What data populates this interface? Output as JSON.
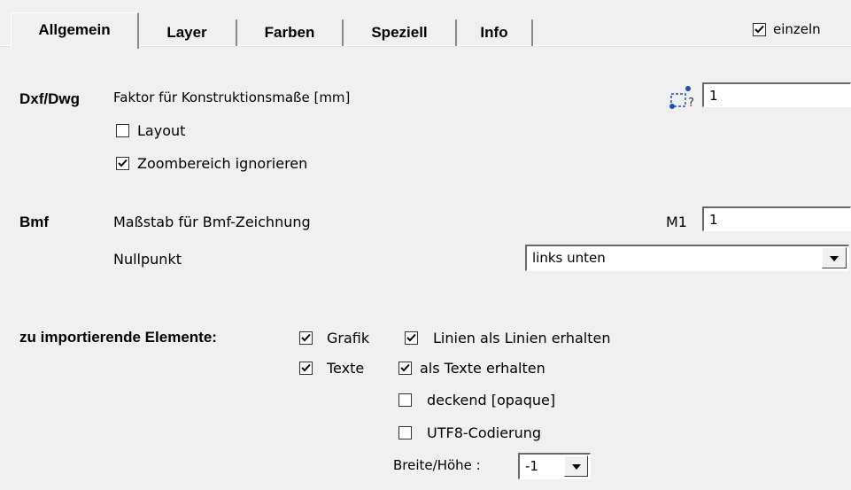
{
  "tabs": [
    {
      "label": "Allgemein",
      "active": true
    },
    {
      "label": "Layer",
      "active": false
    },
    {
      "label": "Farben",
      "active": false
    },
    {
      "label": "Speziell",
      "active": false
    },
    {
      "label": "Info",
      "active": false
    }
  ],
  "einzeln": {
    "label": "einzeln",
    "checked": true
  },
  "dxf": {
    "section_label": "Dxf/Dwg",
    "factor_label": "Faktor für Konstruktionsmaße [mm]",
    "factor_value": "1",
    "pick_icon": "measure-pick-icon",
    "layout": {
      "label": "Layout",
      "checked": false
    },
    "zoom": {
      "label": "Zoombereich ignorieren",
      "checked": true
    }
  },
  "bmf": {
    "section_label": "Bmf",
    "scale_label": "Maßstab für Bmf-Zeichnung",
    "scale_prefix": "M1",
    "scale_value": "1",
    "origin_label": "Nullpunkt",
    "origin_value": "links unten"
  },
  "import": {
    "section_label": "zu importierende Elemente:",
    "grafik": {
      "label": "Grafik",
      "checked": true
    },
    "linien": {
      "label": "Linien als Linien erhalten",
      "checked": true
    },
    "texte": {
      "label": "Texte",
      "checked": true
    },
    "als_texte": {
      "label": "als Texte erhalten",
      "checked": true
    },
    "deckend": {
      "label": "deckend [opaque]",
      "checked": false
    },
    "utf8": {
      "label": "UTF8-Codierung",
      "checked": false
    },
    "size_label": "Breite/Höhe :",
    "size_value": "-1"
  },
  "colors": {
    "background": "#f0f0f0",
    "icon_blue": "#1f4fb3"
  }
}
